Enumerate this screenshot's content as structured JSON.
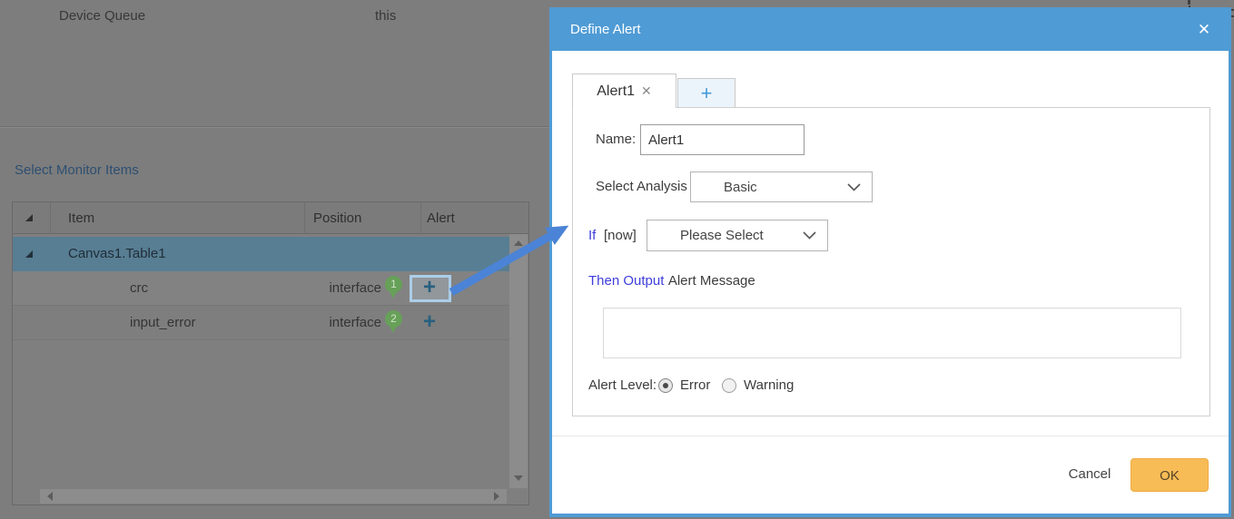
{
  "background": {
    "top_bar": {
      "device_queue_label": "Device Queue",
      "this_label": "this"
    },
    "section_title": "Select Monitor Items",
    "table": {
      "headers": {
        "item": "Item",
        "position": "Position",
        "alert": "Alert"
      },
      "group_row": {
        "label": "Canvas1.Table1"
      },
      "rows": [
        {
          "item": "crc",
          "position": "interface",
          "pin_number": "1",
          "add_glyph": "+",
          "selected": true
        },
        {
          "item": "input_error",
          "position": "interface",
          "pin_number": "2",
          "add_glyph": "+",
          "selected": false
        }
      ]
    }
  },
  "dialog": {
    "title": "Define Alert",
    "close_glyph": "✕",
    "tabs": {
      "active_label": "Alert1",
      "active_close_glyph": "✕",
      "add_glyph": "+"
    },
    "form": {
      "name_label": "Name:",
      "name_value": "Alert1",
      "analysis_label": "Select Analysis",
      "analysis_value": "Basic",
      "if_label": "If",
      "now_label": "[now]",
      "condition_value": "Please Select",
      "then_label": "Then Output",
      "then_suffix": "Alert Message",
      "message_value": "",
      "alert_level_label": "Alert Level:",
      "level_options": [
        {
          "label": "Error",
          "selected": true
        },
        {
          "label": "Warning",
          "selected": false
        }
      ]
    },
    "footer": {
      "cancel_label": "Cancel",
      "ok_label": "OK"
    }
  },
  "colors": {
    "dialog_accent": "#4f9bd5",
    "ok_button_bg": "#f8bc56",
    "blue_keyword_text": "#3d3ddb",
    "arrow_blue": "#4b83d6",
    "pin_green": "#67a058",
    "selected_row_bg": "#587e93",
    "add_icon_blue": "#27607f",
    "tab_add_blue": "#3f9bd8",
    "section_title_color": "#2e4f71"
  }
}
